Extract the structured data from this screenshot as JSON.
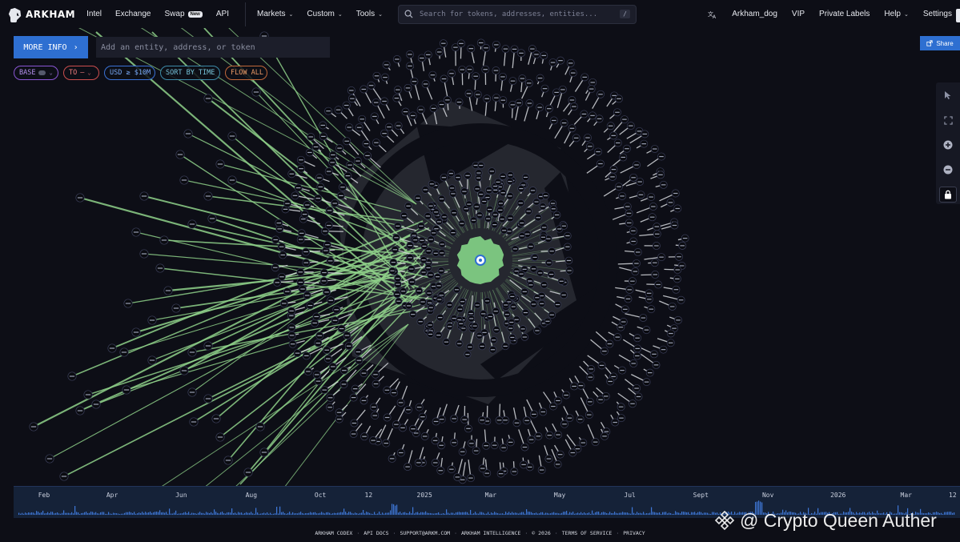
{
  "nav": {
    "brand": "ARKHAM",
    "items": [
      {
        "label": "Intel"
      },
      {
        "label": "Exchange"
      },
      {
        "label": "Swap",
        "badge": "New"
      },
      {
        "label": "API"
      }
    ],
    "menus": [
      {
        "label": "Markets"
      },
      {
        "label": "Custom"
      },
      {
        "label": "Tools"
      }
    ],
    "search_placeholder": "Search for tokens, addresses, entities...",
    "search_shortcut": "/",
    "right": [
      {
        "label": "Arkham_dog"
      },
      {
        "label": "VIP"
      },
      {
        "label": "Private Labels"
      },
      {
        "label": "Help",
        "dropdown": true
      },
      {
        "label": "Settings"
      }
    ]
  },
  "controls": {
    "more_info": "MORE INFO",
    "entity_placeholder": "Add an entity, address, or token",
    "filters": {
      "base": "BASE",
      "to": "TO",
      "usd": "USD ≥ $10M",
      "sort": "SORT BY TIME",
      "flow": "FLOW ALL"
    },
    "share": "Share"
  },
  "timeline": {
    "labels": [
      {
        "text": "Feb",
        "pos": 0.026
      },
      {
        "text": "Apr",
        "pos": 0.098
      },
      {
        "text": "Jun",
        "pos": 0.171
      },
      {
        "text": "Aug",
        "pos": 0.245
      },
      {
        "text": "Oct",
        "pos": 0.318
      },
      {
        "text": "12",
        "pos": 0.371
      },
      {
        "text": "2025",
        "pos": 0.426
      },
      {
        "text": "Mar",
        "pos": 0.498
      },
      {
        "text": "May",
        "pos": 0.571
      },
      {
        "text": "Jul",
        "pos": 0.645
      },
      {
        "text": "Sept",
        "pos": 0.718
      },
      {
        "text": "Nov",
        "pos": 0.791
      },
      {
        "text": "2026",
        "pos": 0.863
      },
      {
        "text": "Mar",
        "pos": 0.937
      },
      {
        "text": "12",
        "pos": 0.992
      }
    ]
  },
  "footer": {
    "links": [
      "ARKHAM CODEX",
      "API DOCS",
      "SUPPORT@ARKM.COM",
      "ARKHAM INTELLIGENCE",
      "© 2026",
      "TERMS OF SERVICE",
      "PRIVACY"
    ]
  },
  "watermark": "@ Crypto Queen Auther",
  "icons": {
    "logo": "arkham-logo-icon",
    "search": "search-icon",
    "translate": "translate-icon",
    "share": "share-icon",
    "tools": [
      "pointer-icon",
      "fit-screen-icon",
      "zoom-in-icon",
      "zoom-out-icon",
      "lock-icon"
    ]
  },
  "colors": {
    "background": "#0d0e16",
    "accent": "#2e6fd1",
    "flow_edge": "#8fd18a",
    "center_node": "#7bc47f",
    "ring_edge": "#d6d8dd",
    "logo_shape": "#262830"
  }
}
